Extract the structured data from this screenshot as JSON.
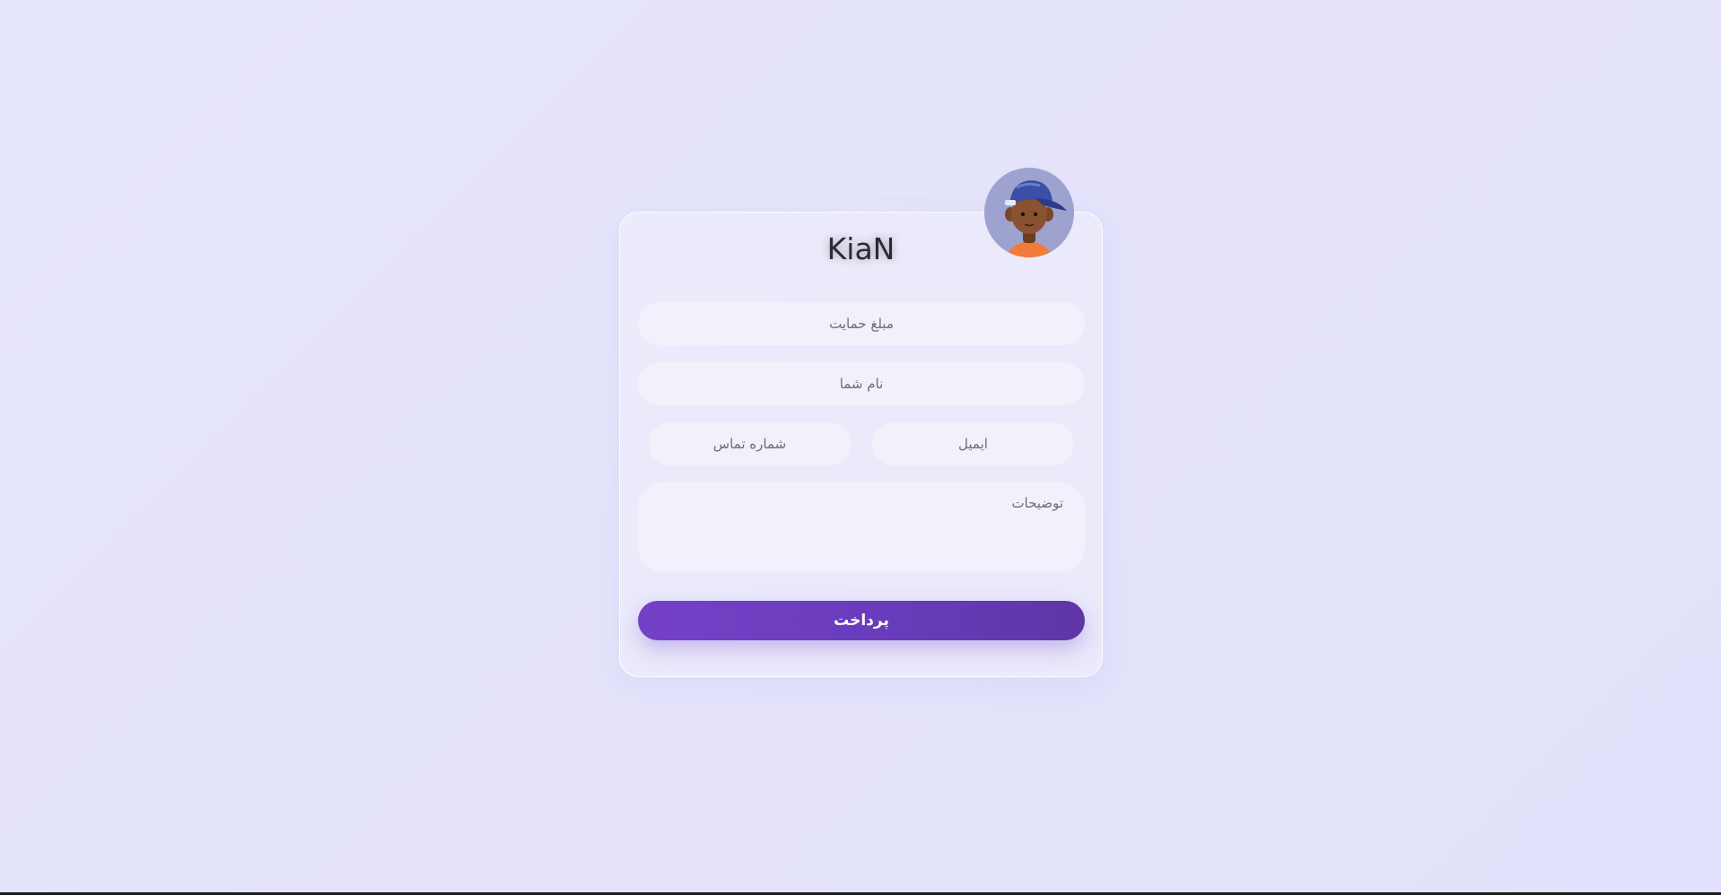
{
  "profile": {
    "name": "KiaN",
    "avatar_icon": "avatar-boy-cap-icon"
  },
  "form": {
    "amount_placeholder": "مبلغ حمایت",
    "name_placeholder": "نام شما",
    "phone_placeholder": "شماره تماس",
    "email_placeholder": "ایمیل",
    "description_placeholder": "توضیحات",
    "submit_label": "پرداخت"
  },
  "colors": {
    "background": "#e4e3fb",
    "accent": "#6a3cbd",
    "field_bg": "#f1f1fb"
  }
}
